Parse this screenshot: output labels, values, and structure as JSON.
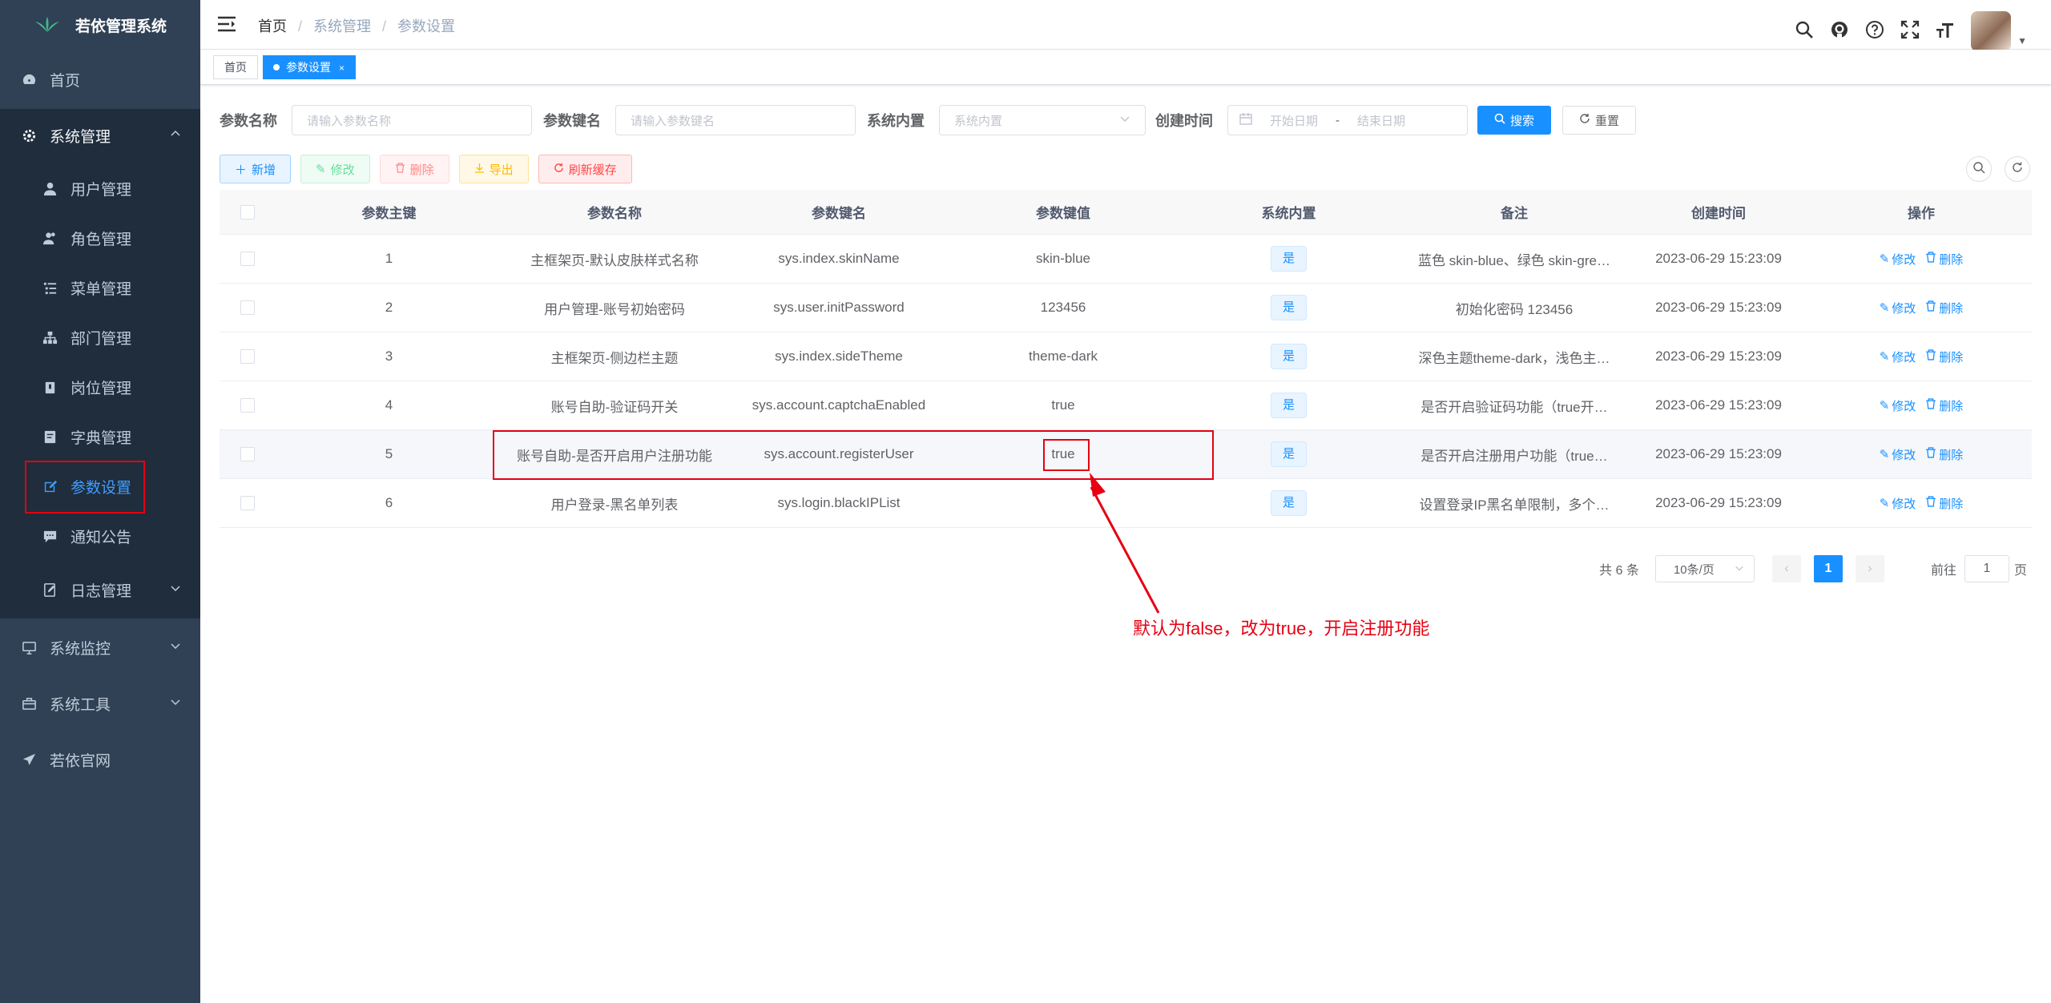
{
  "app": {
    "title": "若依管理系统"
  },
  "sidebar": {
    "items": [
      {
        "label": "首页",
        "icon": "dashboard-icon"
      },
      {
        "label": "系统管理",
        "icon": "gear-icon",
        "expanded": true
      },
      {
        "label": "用户管理",
        "icon": "user-icon"
      },
      {
        "label": "角色管理",
        "icon": "peoples-icon"
      },
      {
        "label": "菜单管理",
        "icon": "tree-table-icon"
      },
      {
        "label": "部门管理",
        "icon": "tree-icon"
      },
      {
        "label": "岗位管理",
        "icon": "post-icon"
      },
      {
        "label": "字典管理",
        "icon": "dict-icon"
      },
      {
        "label": "参数设置",
        "icon": "edit-icon",
        "active": true
      },
      {
        "label": "通知公告",
        "icon": "message-icon"
      },
      {
        "label": "日志管理",
        "icon": "log-icon"
      },
      {
        "label": "系统监控",
        "icon": "monitor-icon"
      },
      {
        "label": "系统工具",
        "icon": "tool-icon"
      },
      {
        "label": "若依官网",
        "icon": "guide-icon"
      }
    ]
  },
  "breadcrumb": [
    "首页",
    "系统管理",
    "参数设置"
  ],
  "tags": [
    "首页",
    "参数设置"
  ],
  "search": {
    "config_name_label": "参数名称",
    "config_name_placeholder": "请输入参数名称",
    "config_key_label": "参数键名",
    "config_key_placeholder": "请输入参数键名",
    "config_type_label": "系统内置",
    "config_type_placeholder": "系统内置",
    "created_label": "创建时间",
    "start_placeholder": "开始日期",
    "range_sep": "-",
    "end_placeholder": "结束日期",
    "search_btn": "搜索",
    "reset_btn": "重置"
  },
  "toolbar": {
    "add": "新增",
    "edit": "修改",
    "delete": "删除",
    "export": "导出",
    "refresh_cache": "刷新缓存"
  },
  "table": {
    "headers": [
      "参数主键",
      "参数名称",
      "参数键名",
      "参数键值",
      "系统内置",
      "备注",
      "创建时间",
      "操作"
    ],
    "rows": [
      {
        "id": "1",
        "name": "主框架页-默认皮肤样式名称",
        "key": "sys.index.skinName",
        "value": "skin-blue",
        "builtin": "是",
        "remark": "蓝色 skin-blue、绿色 skin-gre…",
        "created": "2023-06-29 15:23:09"
      },
      {
        "id": "2",
        "name": "用户管理-账号初始密码",
        "key": "sys.user.initPassword",
        "value": "123456",
        "builtin": "是",
        "remark": "初始化密码 123456",
        "created": "2023-06-29 15:23:09"
      },
      {
        "id": "3",
        "name": "主框架页-侧边栏主题",
        "key": "sys.index.sideTheme",
        "value": "theme-dark",
        "builtin": "是",
        "remark": "深色主题theme-dark，浅色主…",
        "created": "2023-06-29 15:23:09"
      },
      {
        "id": "4",
        "name": "账号自助-验证码开关",
        "key": "sys.account.captchaEnabled",
        "value": "true",
        "builtin": "是",
        "remark": "是否开启验证码功能（true开…",
        "created": "2023-06-29 15:23:09"
      },
      {
        "id": "5",
        "name": "账号自助-是否开启用户注册功能",
        "key": "sys.account.registerUser",
        "value": "true",
        "builtin": "是",
        "remark": "是否开启注册用户功能（true…",
        "created": "2023-06-29 15:23:09"
      },
      {
        "id": "6",
        "name": "用户登录-黑名单列表",
        "key": "sys.login.blackIPList",
        "value": "",
        "builtin": "是",
        "remark": "设置登录IP黑名单限制，多个…",
        "created": "2023-06-29 15:23:09"
      }
    ],
    "op_edit": "修改",
    "op_delete": "删除"
  },
  "pagination": {
    "total": "共 6 条",
    "page_size": "10条/页",
    "current": "1",
    "goto_prefix": "前往",
    "goto_value": "1",
    "goto_suffix": "页"
  },
  "annotation": "默认为false，改为true，开启注册功能",
  "colors": {
    "sidebar": "#304156",
    "submenu": "#1f2d3d",
    "primary": "#1890ff",
    "annotation": "#e60012"
  }
}
